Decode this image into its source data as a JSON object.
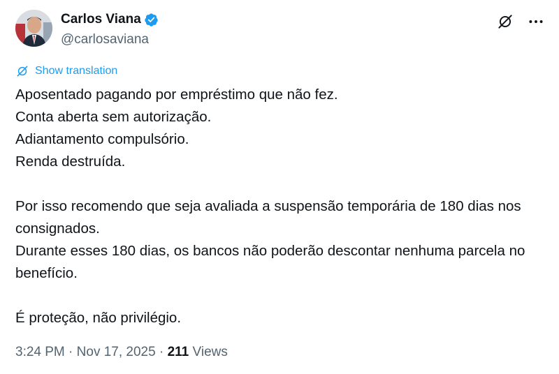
{
  "author": {
    "display_name": "Carlos Viana",
    "handle": "@carlosaviana",
    "verified": true,
    "verified_color": "#1d9bf0"
  },
  "actions": {
    "grok_icon": "grok-icon",
    "more_icon": "more-icon"
  },
  "translate": {
    "label": "Show translation",
    "icon": "translate-icon",
    "color": "#1d9bf0"
  },
  "tweet": {
    "lines_group1": [
      "Aposentado pagando por empréstimo que não fez.",
      "Conta aberta sem autorização.",
      "Adiantamento compulsório.",
      "Renda destruída."
    ],
    "lines_group2": [
      "Por isso recomendo que seja avaliada a suspensão temporária de 180 dias nos consignados.",
      "Durante esses 180 dias, os bancos não poderão descontar nenhuma parcela no benefício."
    ],
    "closing": "É proteção, não privilégio."
  },
  "meta": {
    "time": "3:24 PM",
    "sep1": " · ",
    "date": "Nov 17, 2025",
    "sep2": " · ",
    "views_count": "211",
    "views_label": " Views"
  }
}
